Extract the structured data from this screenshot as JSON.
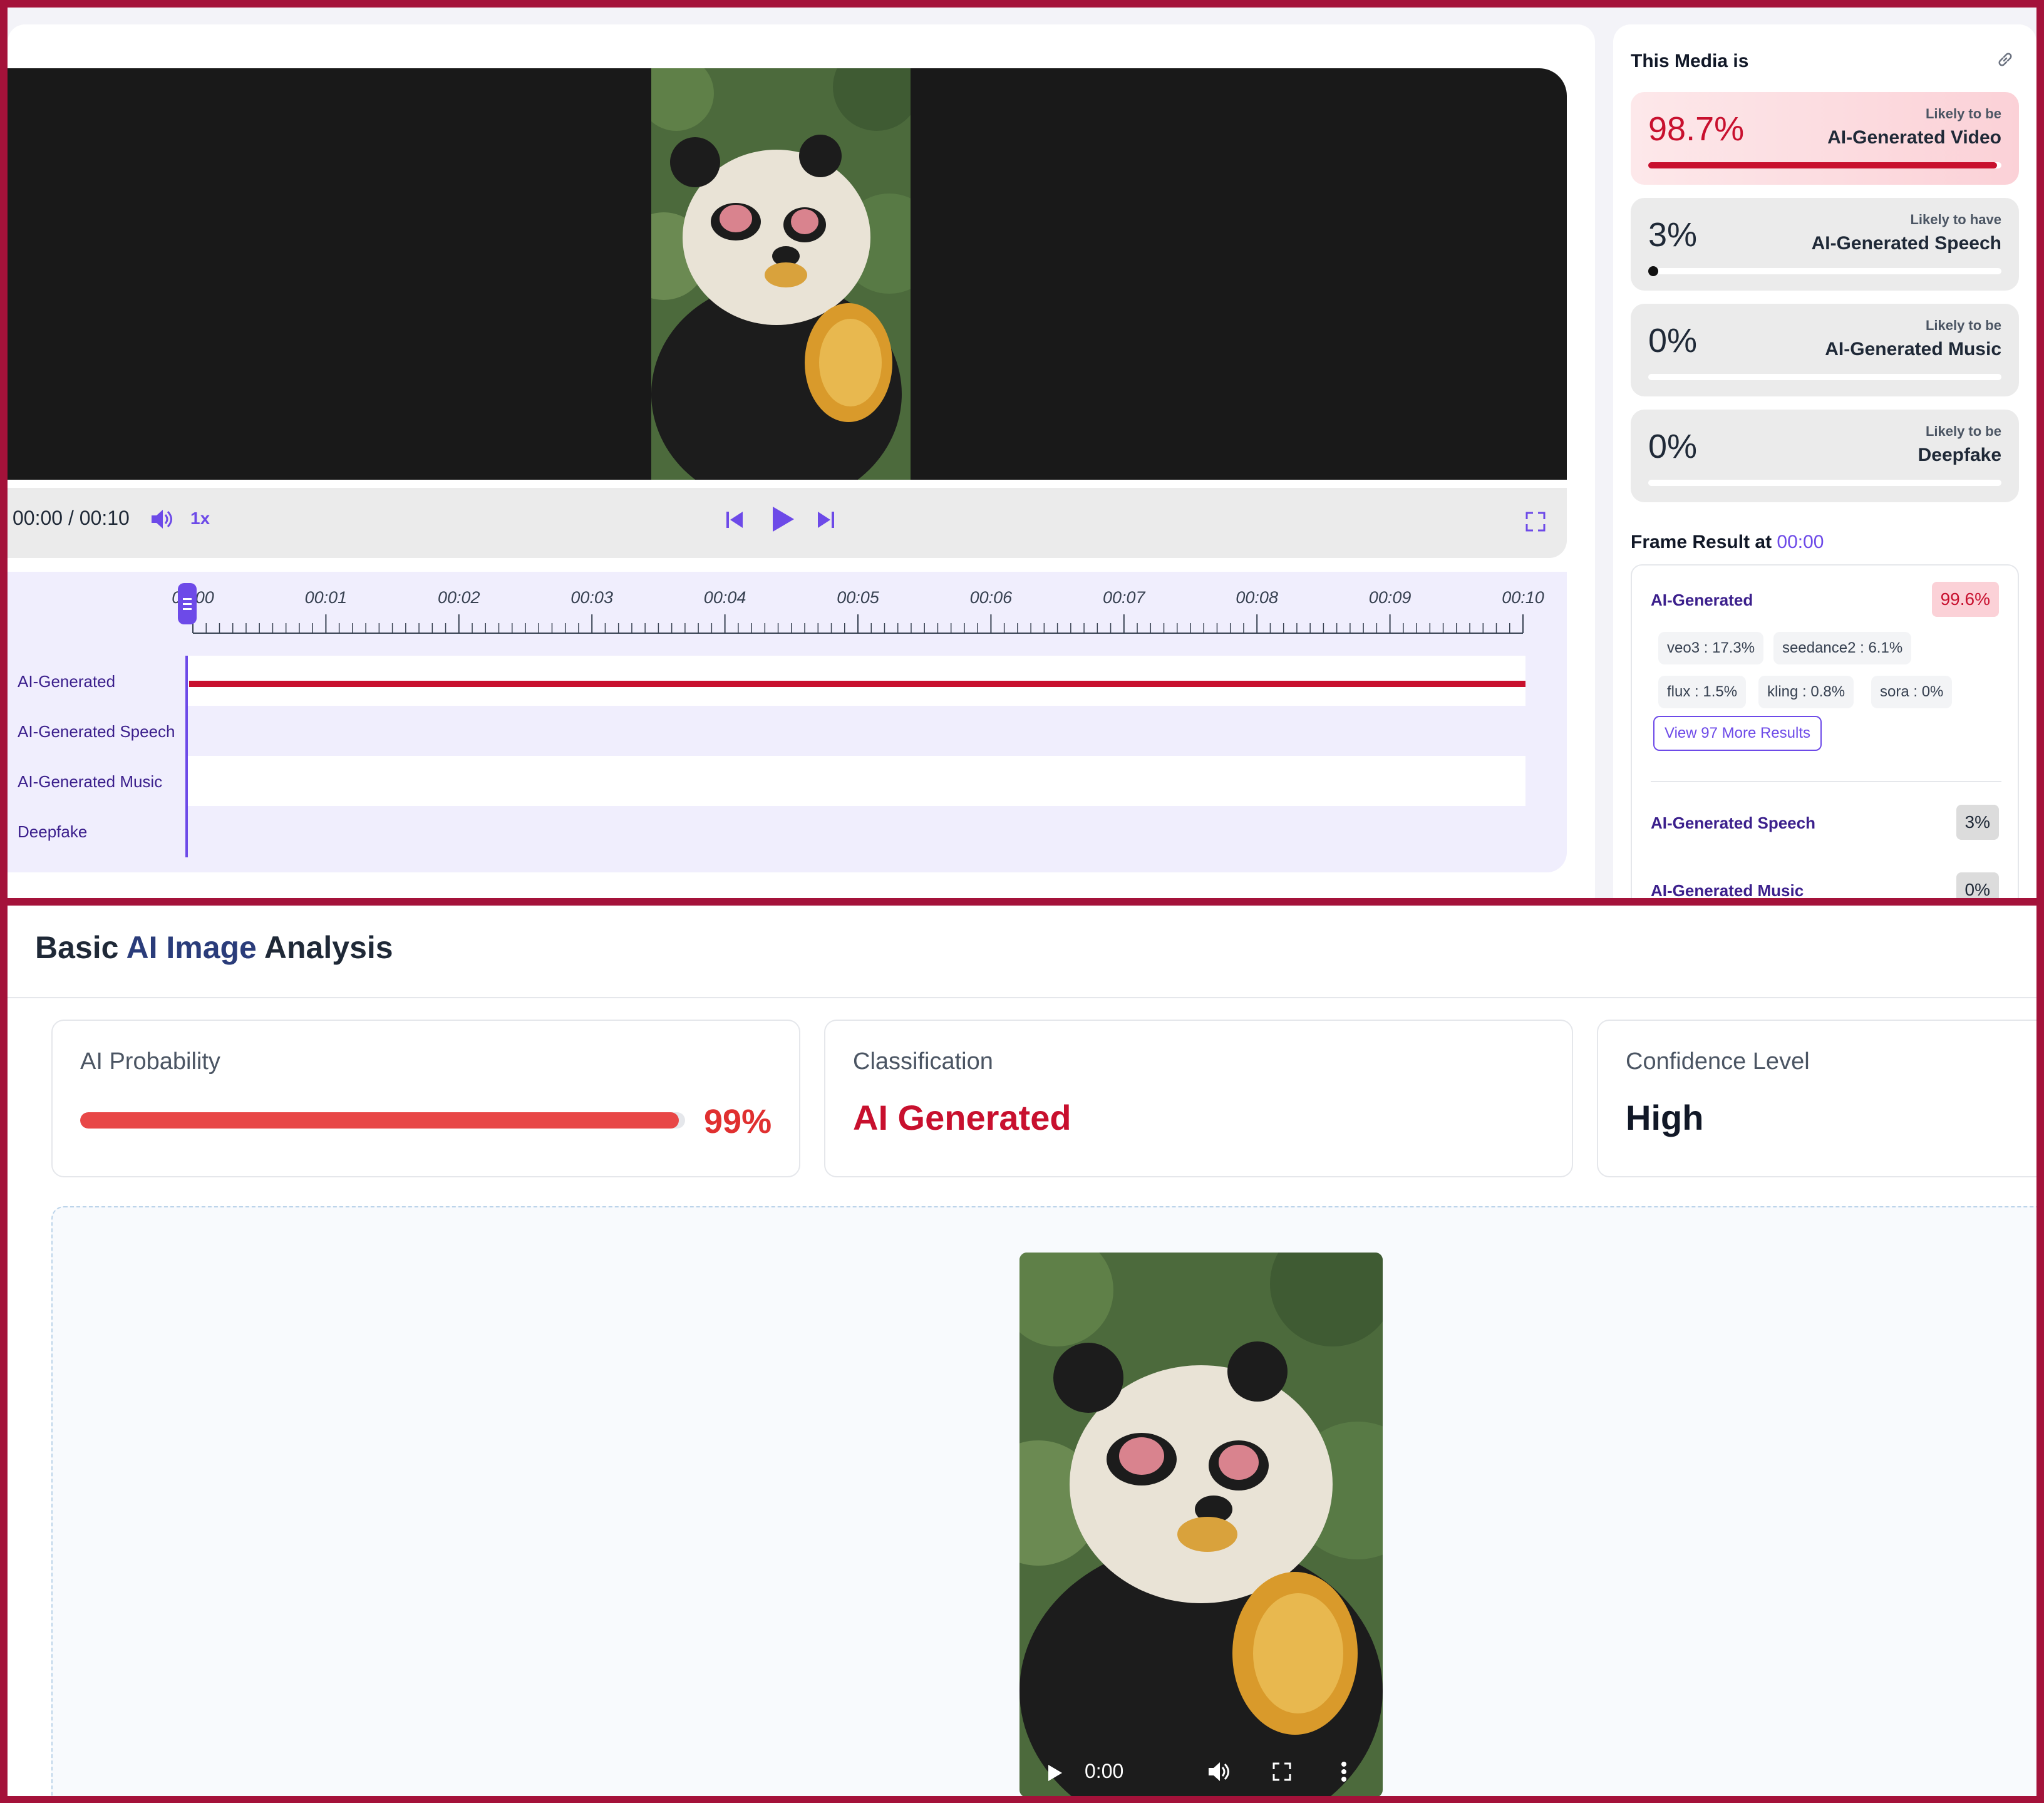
{
  "player": {
    "time": "00:00 / 00:10",
    "speed": "1x",
    "ticks": [
      "00:00",
      "00:01",
      "00:02",
      "00:03",
      "00:04",
      "00:05",
      "00:06",
      "00:07",
      "00:08",
      "00:09",
      "00:10"
    ],
    "playhead_fraction": 0,
    "tracks": [
      "AI-Generated",
      "AI-Generated Speech",
      "AI-Generated Music",
      "Deepfake"
    ],
    "icons": [
      "volume-icon",
      "previous-icon",
      "play-icon",
      "next-icon",
      "fullscreen-icon"
    ]
  },
  "summary": {
    "heading": "This Media is",
    "cards": [
      {
        "pct": "98.7%",
        "sub": "Likely to be",
        "label": "AI-Generated Video",
        "value": 0.987
      },
      {
        "pct": "3%",
        "sub": "Likely to have",
        "label": "AI-Generated Speech",
        "value": 0.03
      },
      {
        "pct": "0%",
        "sub": "Likely to be",
        "label": "AI-Generated Music",
        "value": 0
      },
      {
        "pct": "0%",
        "sub": "Likely to be",
        "label": "Deepfake",
        "value": 0
      }
    ]
  },
  "frame_result": {
    "heading": "Frame Result at",
    "time": "00:00",
    "ai_generated": {
      "label": "AI-Generated",
      "value": "99.6%"
    },
    "models": [
      {
        "name": "veo3",
        "sep": ":",
        "value": "17.3%"
      },
      {
        "name": "seedance2",
        "sep": ":",
        "value": "6.1%"
      },
      {
        "name": "flux",
        "sep": ":",
        "value": "1.5%"
      },
      {
        "name": "kling",
        "sep": ":",
        "value": "0.8%"
      },
      {
        "name": "sora",
        "sep": ":",
        "value": "0%"
      }
    ],
    "more_button": "View 97 More Results",
    "speech": {
      "label": "AI-Generated Speech",
      "value": "3%"
    },
    "music": {
      "label": "AI-Generated Music",
      "value": "0%"
    }
  },
  "analysis": {
    "title_prefix": "Basic ",
    "title_highlight": "AI Image",
    "title_suffix": " Analysis",
    "probability": {
      "label": "AI Probability",
      "value": "99%",
      "fraction": 0.99
    },
    "classification": {
      "label": "Classification",
      "value": "AI Generated"
    },
    "confidence": {
      "label": "Confidence Level",
      "value": "High"
    },
    "preview_time": "0:00"
  },
  "colors": {
    "frame_border": "#a4123a",
    "accent": "#6d4ae8",
    "alert_red": "#c8102e"
  }
}
